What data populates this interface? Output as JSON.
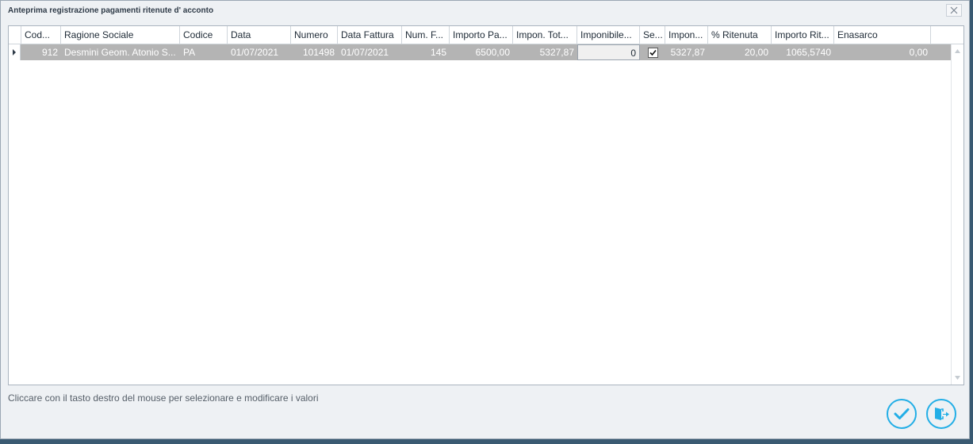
{
  "window": {
    "title": "Anteprima registrazione pagamenti ritenute d' acconto"
  },
  "grid": {
    "columns": [
      {
        "label": "Cod..."
      },
      {
        "label": "Ragione Sociale"
      },
      {
        "label": "Codice"
      },
      {
        "label": "Data"
      },
      {
        "label": "Numero"
      },
      {
        "label": "Data Fattura"
      },
      {
        "label": "Num. F..."
      },
      {
        "label": "Importo Pa..."
      },
      {
        "label": "Impon. Tot..."
      },
      {
        "label": "Imponibile..."
      },
      {
        "label": "Se..."
      },
      {
        "label": "Impon..."
      },
      {
        "label": "% Ritenuta"
      },
      {
        "label": "Importo Rit..."
      },
      {
        "label": "Enasarco"
      }
    ],
    "rows": [
      {
        "cod": "912",
        "ragione_sociale": "Desmini Geom. Atonio S...",
        "codice": "PA",
        "data": "01/07/2021",
        "numero": "101498",
        "data_fattura": "01/07/2021",
        "num_f": "145",
        "importo_pa": "6500,00",
        "impon_tot": "5327,87",
        "imponibile": "0",
        "selected": true,
        "impon": "5327,87",
        "perc_ritenuta": "20,00",
        "importo_rit": "1065,5740",
        "enasarco": "0,00"
      }
    ]
  },
  "hint": "Cliccare con il tasto destro del mouse per selezionare e modificare i valori",
  "colors": {
    "accent": "#22aee6",
    "row_selected": "#b4b4b4"
  },
  "icons": {
    "confirm": "check-icon",
    "exit": "exit-door-icon",
    "close": "close-icon"
  }
}
